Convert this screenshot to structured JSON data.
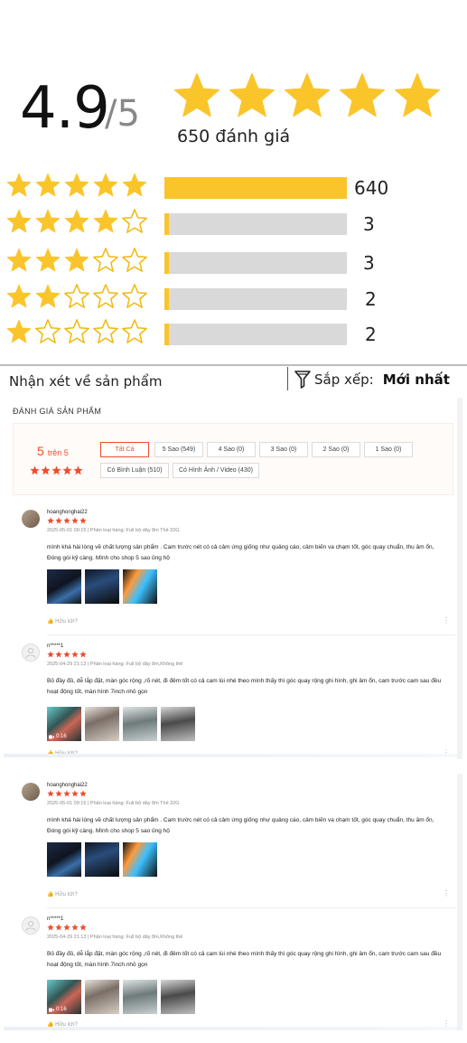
{
  "summary": {
    "score": "4.9",
    "out_of": "/5",
    "total_reviews": "650 đánh giá",
    "star_color": "#fac52b",
    "empty_star_stroke": "#f0b90b"
  },
  "breakdown": [
    {
      "stars": 5,
      "count": "640",
      "fill_fraction": 1.0
    },
    {
      "stars": 4,
      "count": "3",
      "fill_fraction": 0.02
    },
    {
      "stars": 3,
      "count": "3",
      "fill_fraction": 0.02
    },
    {
      "stars": 2,
      "count": "2",
      "fill_fraction": 0.02
    },
    {
      "stars": 1,
      "count": "2",
      "fill_fraction": 0.02
    }
  ],
  "header": {
    "section_title": "Nhận xét về sản phẩm",
    "sort_label": "Sắp xếp:",
    "sort_value": "Mới nhất",
    "sort_icon": "filter-funnel-icon"
  },
  "shop_panel": {
    "title": "ĐÁNH GIÁ SẢN PHẨM",
    "score_big": "5",
    "score_suffix": "trên 5",
    "accent_color": "#ee4d2d",
    "filters": [
      "Tất Cả",
      "5 Sao (549)",
      "4 Sao (0)",
      "3 Sao (0)",
      "2 Sao (0)",
      "1 Sao (0)",
      "Có Bình Luận (510)",
      "Có Hình Ảnh / Video (430)"
    ],
    "reviews": [
      {
        "name": "hoanghonghai22",
        "meta": "2025-05-01 09:15 | Phân loại hàng: Full bộ dây 8m Thẻ 32G",
        "text": "mình khá hài lòng về chất lượng sản phẩm . Cam  trước nét có cả cảm ứng giống như quảng cáo, cảm biến va chạm tốt, góc quay chuẩn, thu âm ổn, Đóng gói kỹ càng. Mình cho shop 5 sao ủng hộ",
        "helpful": "Hữu ích?",
        "video_time": ""
      },
      {
        "name": "n*****1",
        "meta": "2025-04-29 21:13 | Phân loại hàng: Full bộ dây 8m,Không thẻ",
        "text": "Bỏ đầy đủ, dễ lắp đặt, màn góc rộng ,rõ nét, đi đêm tốt có cả cam lùi nhé theo mình thấy thì góc quay rộng ghi hình, ghi âm ổn, cam trước cam sau đều hoạt động tốt, màn hình 7inch nhỏ gọn",
        "helpful": "Hữu ích?",
        "video_time": "0:16"
      }
    ]
  }
}
